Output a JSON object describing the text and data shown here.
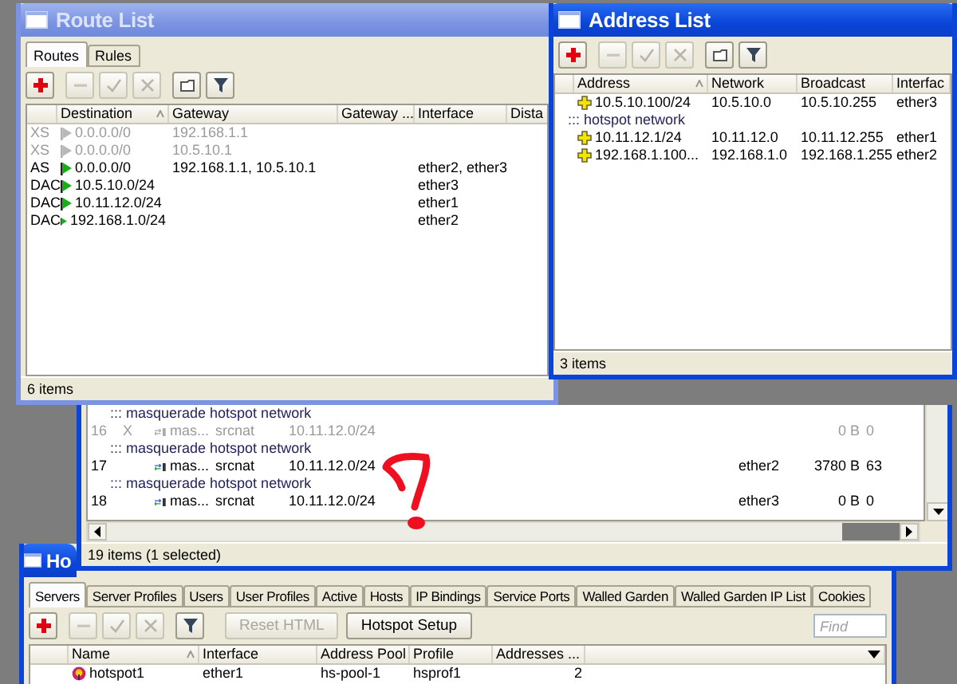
{
  "route_list": {
    "title": "Route List",
    "tabs": [
      {
        "label": "Routes",
        "selected": true
      },
      {
        "label": "Rules",
        "selected": false
      }
    ],
    "toolbar": [
      {
        "kind": "add",
        "disabled": false
      },
      {
        "kind": "remove",
        "disabled": true
      },
      {
        "kind": "enable",
        "disabled": true
      },
      {
        "kind": "disable",
        "disabled": true
      },
      {
        "kind": "comment",
        "disabled": false
      },
      {
        "kind": "filter",
        "disabled": false
      }
    ],
    "columns": [
      {
        "label": "Destination",
        "sorted": true
      },
      {
        "label": "Gateway",
        "sorted": false
      },
      {
        "label": "Gateway ...",
        "sorted": false
      },
      {
        "label": "Interface",
        "sorted": false
      },
      {
        "label": "Dista",
        "sorted": false
      }
    ],
    "rows": [
      {
        "flags": "XS",
        "disabled": true,
        "destination": "0.0.0.0/0",
        "gateway": "192.168.1.1"
      },
      {
        "flags": "XS",
        "disabled": true,
        "destination": "0.0.0.0/0",
        "gateway": "10.5.10.1"
      },
      {
        "flags": "AS",
        "disabled": false,
        "destination": "0.0.0.0/0",
        "gateway": "192.168.1.1, 10.5.10.1",
        "interface": "ether2, ether3"
      },
      {
        "flags": "DAC",
        "disabled": false,
        "destination": "10.5.10.0/24",
        "interface": "ether3"
      },
      {
        "flags": "DAC",
        "disabled": false,
        "destination": "10.11.12.0/24",
        "interface": "ether1"
      },
      {
        "flags": "DAC",
        "disabled": false,
        "destination": "192.168.1.0/24",
        "interface": "ether2"
      }
    ],
    "status": "6 items"
  },
  "address_list": {
    "title": "Address List",
    "toolbar": [
      {
        "kind": "add",
        "disabled": false
      },
      {
        "kind": "remove",
        "disabled": true
      },
      {
        "kind": "enable",
        "disabled": true
      },
      {
        "kind": "disable",
        "disabled": true
      },
      {
        "kind": "comment",
        "disabled": false
      },
      {
        "kind": "filter",
        "disabled": false
      }
    ],
    "columns": [
      {
        "label": "Address",
        "sorted": true
      },
      {
        "label": "Network",
        "sorted": false
      },
      {
        "label": "Broadcast",
        "sorted": false
      },
      {
        "label": "Interfac",
        "sorted": false
      }
    ],
    "rows": [
      {
        "kind": "address",
        "address": "10.5.10.100/24",
        "network": "10.5.10.0",
        "broadcast": "10.5.10.255",
        "interface": "ether3"
      },
      {
        "kind": "comment",
        "text": "::: hotspot network"
      },
      {
        "kind": "address",
        "address": "10.11.12.1/24",
        "network": "10.11.12.0",
        "broadcast": "10.11.12.255",
        "interface": "ether1"
      },
      {
        "kind": "address",
        "address": "192.168.1.100...",
        "network": "192.168.1.0",
        "broadcast": "192.168.1.255",
        "interface": "ether2"
      }
    ],
    "status": "3 items"
  },
  "nat_list": {
    "rows": [
      {
        "kind": "comment",
        "text": "::: masquerade hotspot network"
      },
      {
        "kind": "rule",
        "disabled": true,
        "column_1": "16",
        "column_2": "X",
        "column_3": "mas...",
        "column_4": "srcnat",
        "column_5": "10.11.12.0/24",
        "column_12": "0 B",
        "column_13": "0"
      },
      {
        "kind": "comment",
        "text": "::: masquerade hotspot network"
      },
      {
        "kind": "rule",
        "disabled": false,
        "column_1": "17",
        "column_3": "mas...",
        "column_4": "srcnat",
        "column_5": "10.11.12.0/24",
        "column_11": "ether2",
        "column_12": "3780 B",
        "column_13": "63"
      },
      {
        "kind": "comment",
        "text": "::: masquerade hotspot network"
      },
      {
        "kind": "rule",
        "disabled": false,
        "column_1": "18",
        "column_3": "mas...",
        "column_4": "srcnat",
        "column_5": "10.11.12.0/24",
        "column_11": "ether3",
        "column_12": "0 B",
        "column_13": "0"
      }
    ],
    "status": "19 items (1 selected)"
  },
  "hotspot": {
    "title": "Ho",
    "tabs": [
      {
        "label": "Servers",
        "selected": true
      },
      {
        "label": "Server Profiles",
        "selected": false
      },
      {
        "label": "Users",
        "selected": false
      },
      {
        "label": "User Profiles",
        "selected": false
      },
      {
        "label": "Active",
        "selected": false
      },
      {
        "label": "Hosts",
        "selected": false
      },
      {
        "label": "IP Bindings",
        "selected": false
      },
      {
        "label": "Service Ports",
        "selected": false
      },
      {
        "label": "Walled Garden",
        "selected": false
      },
      {
        "label": "Walled Garden IP List",
        "selected": false
      },
      {
        "label": "Cookies",
        "selected": false
      }
    ],
    "toolbar": [
      {
        "kind": "add",
        "disabled": false
      },
      {
        "kind": "remove",
        "disabled": true
      },
      {
        "kind": "enable",
        "disabled": true
      },
      {
        "kind": "disable",
        "disabled": true
      },
      {
        "kind": "filter",
        "disabled": false
      }
    ],
    "buttons": [
      {
        "label": "Reset HTML",
        "disabled": true
      },
      {
        "label": "Hotspot Setup",
        "disabled": false
      }
    ],
    "find": {
      "placeholder": "Find"
    },
    "columns": [
      {
        "label": "Name",
        "sorted": true
      },
      {
        "label": "Interface",
        "sorted": false
      },
      {
        "label": "Address Pool",
        "sorted": false
      },
      {
        "label": "Profile",
        "sorted": false
      },
      {
        "label": "Addresses ...",
        "sorted": false
      }
    ],
    "rows": [
      {
        "name": "hotspot1",
        "interface": "ether1",
        "address_pool": "hs-pool-1",
        "profile": "hsprof1",
        "addresses": "2"
      }
    ]
  }
}
